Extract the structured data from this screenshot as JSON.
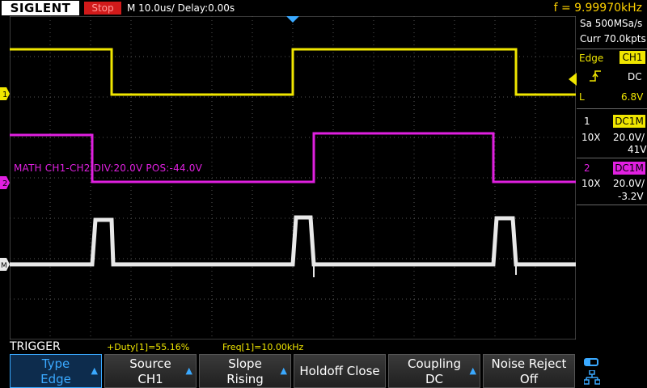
{
  "header": {
    "logo": "SIGLENT",
    "run_status": "Stop",
    "timebase": "M 10.0us/  Delay:0.00s",
    "frequency": "f = 9.99970kHz"
  },
  "acquisition": {
    "sample_rate": "Sa 500MSa/s",
    "memory": "Curr 70.0kpts"
  },
  "trigger_panel": {
    "type_label": "Edge",
    "source_badge": "CH1",
    "coupling": "DC",
    "level_marker": "L",
    "level": "6.8V"
  },
  "channels": [
    {
      "number": "1",
      "badge": "DC1M",
      "probe": "10X",
      "scale": "20.0V/",
      "offset": "41V",
      "color": "#f0e600"
    },
    {
      "number": "2",
      "badge": "DC1M",
      "probe": "10X",
      "scale": "20.0V/",
      "offset": "-3.2V",
      "color": "#e020e0"
    }
  ],
  "math": {
    "label": "MATH  CH1-CH2  DIV:20.0V  POS:-44.0V",
    "color": "#e020e0"
  },
  "markers": {
    "ch1": "1",
    "ch2": "2",
    "math": "M"
  },
  "measurements": {
    "duty": "+Duty[1]=55.16%",
    "freq": "Freq[1]=10.00kHz"
  },
  "menu": {
    "title": "TRIGGER",
    "softkeys": [
      {
        "line1": "Type",
        "line2": "Edge"
      },
      {
        "line1": "Source",
        "line2": "CH1"
      },
      {
        "line1": "Slope",
        "line2": "Rising"
      },
      {
        "line1": "Holdoff Close",
        "line2": ""
      },
      {
        "line1": "Coupling",
        "line2": "DC"
      },
      {
        "line1": "Noise Reject",
        "line2": "Off"
      }
    ]
  },
  "colors": {
    "ch1": "#f0e600",
    "ch2": "#e020e0",
    "math": "#e8e8e8",
    "accent": "#3aa9ff"
  }
}
